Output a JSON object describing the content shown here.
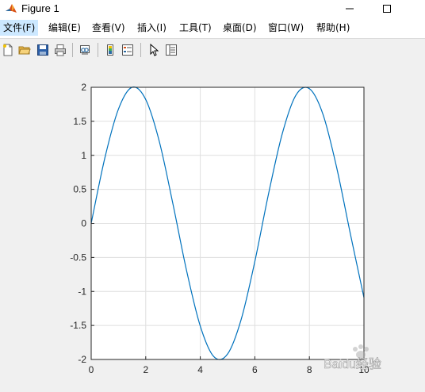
{
  "window": {
    "title": "Figure 1"
  },
  "menu": {
    "items": [
      {
        "label": "文件(F)"
      },
      {
        "label": "编辑(E)"
      },
      {
        "label": "查看(V)"
      },
      {
        "label": "插入(I)"
      },
      {
        "label": "工具(T)"
      },
      {
        "label": "桌面(D)"
      },
      {
        "label": "窗口(W)"
      },
      {
        "label": "帮助(H)"
      }
    ]
  },
  "toolbar": {
    "icons": [
      "new-figure-icon",
      "open-file-icon",
      "save-icon",
      "print-icon",
      "link-plot-icon",
      "insert-colorbar-icon",
      "insert-legend-icon",
      "edit-plot-arrow-icon",
      "open-property-inspector-icon"
    ]
  },
  "watermark": {
    "text": "Baidu经验"
  },
  "chart_data": {
    "type": "line",
    "title": "",
    "xlabel": "",
    "ylabel": "",
    "xlim": [
      0,
      10
    ],
    "ylim": [
      -2,
      2
    ],
    "xticks": [
      0,
      2,
      4,
      6,
      8,
      10
    ],
    "yticks": [
      -2,
      -1.5,
      -1,
      -0.5,
      0,
      0.5,
      1,
      1.5,
      2
    ],
    "xtick_labels": [
      "0",
      "2",
      "4",
      "6",
      "8",
      "10"
    ],
    "ytick_labels": [
      "-2",
      "-1.5",
      "-1",
      "-0.5",
      "0",
      "0.5",
      "1",
      "1.5",
      "2"
    ],
    "grid": true,
    "series": [
      {
        "color": "#0072bd",
        "x": [
          0,
          0.5,
          1,
          1.5,
          2,
          2.5,
          3,
          3.5,
          4,
          4.5,
          5,
          5.5,
          6,
          6.5,
          7,
          7.5,
          8,
          8.5,
          9,
          9.5,
          10
        ],
        "y": [
          0,
          0.96,
          1.68,
          2.0,
          1.82,
          1.2,
          0.28,
          -0.7,
          -1.51,
          -1.96,
          -1.92,
          -1.41,
          -0.56,
          0.43,
          1.31,
          1.88,
          1.98,
          1.6,
          0.82,
          -0.15,
          -1.09
        ]
      }
    ]
  }
}
